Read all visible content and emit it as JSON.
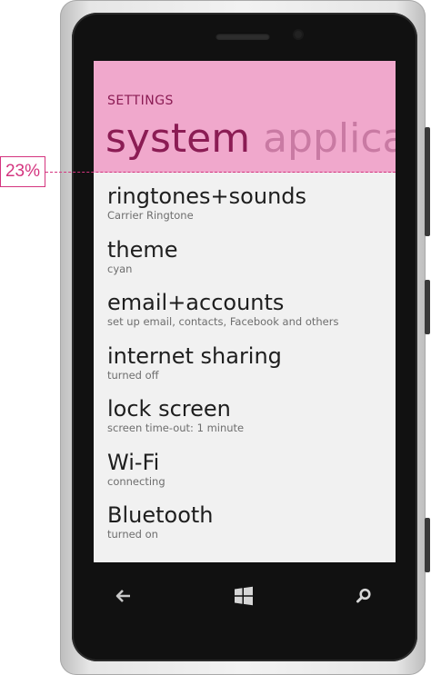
{
  "header": {
    "section_label": "SETTINGS",
    "pivot_active": "system",
    "pivot_next": "applicat"
  },
  "settings_items": [
    {
      "title": "ringtones+sounds",
      "subtitle": "Carrier Ringtone"
    },
    {
      "title": "theme",
      "subtitle": "cyan"
    },
    {
      "title": "email+accounts",
      "subtitle": "set up email, contacts, Facebook and others"
    },
    {
      "title": "internet sharing",
      "subtitle": "turned off"
    },
    {
      "title": "lock screen",
      "subtitle": "screen time-out: 1 minute"
    },
    {
      "title": "Wi-Fi",
      "subtitle": "connecting"
    },
    {
      "title": "Bluetooth",
      "subtitle": "turned on"
    }
  ],
  "nav": {
    "back_icon": "back-arrow-icon",
    "start_icon": "windows-start-icon",
    "search_icon": "search-icon"
  },
  "annotation": {
    "label": "23%"
  },
  "colors": {
    "accent_band": "#f0a8cc",
    "accent_text": "#8b1c54",
    "annotation": "#d4347f"
  }
}
